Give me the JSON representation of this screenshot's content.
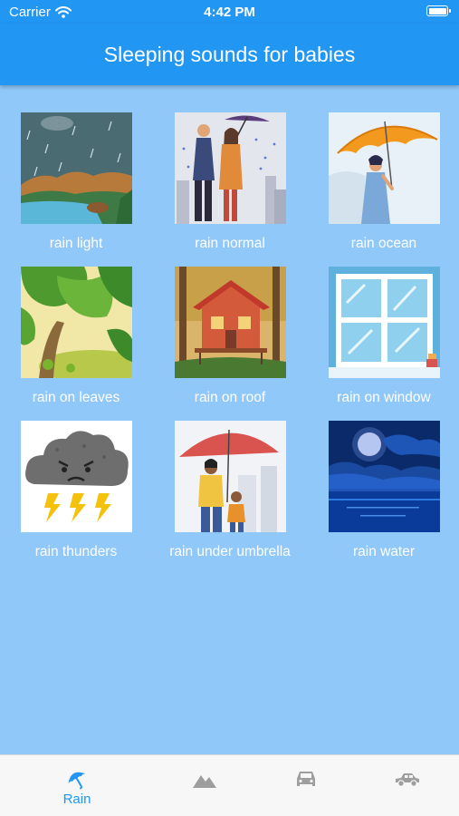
{
  "status": {
    "carrier": "Carrier",
    "time": "4:42 PM"
  },
  "appbar": {
    "title": "Sleeping sounds for babies"
  },
  "tiles": [
    {
      "label": "rain light",
      "image": "rainy-river-landscape-image"
    },
    {
      "label": "rain normal",
      "image": "couple-under-umbrella-city-image"
    },
    {
      "label": "rain ocean",
      "image": "woman-with-orange-umbrella-image"
    },
    {
      "label": "rain on leaves",
      "image": "tropical-leaves-image"
    },
    {
      "label": "rain on roof",
      "image": "red-wooden-house-image"
    },
    {
      "label": "rain on window",
      "image": "window-image"
    },
    {
      "label": "rain thunders",
      "image": "angry-thunder-cloud-image"
    },
    {
      "label": "rain under umbrella",
      "image": "mother-child-red-umbrella-image"
    },
    {
      "label": "rain water",
      "image": "moonlit-night-sea-image"
    }
  ],
  "tabs": [
    {
      "label": "Rain",
      "icon": "umbrella-icon",
      "active": true
    },
    {
      "label": "",
      "icon": "mountain-icon",
      "active": false
    },
    {
      "label": "",
      "icon": "car-icon",
      "active": false
    },
    {
      "label": "",
      "icon": "car-side-icon",
      "active": false
    }
  ],
  "colors": {
    "primary": "#2196f3",
    "background": "#90c8f9",
    "tab_inactive": "#9e9e9e"
  }
}
